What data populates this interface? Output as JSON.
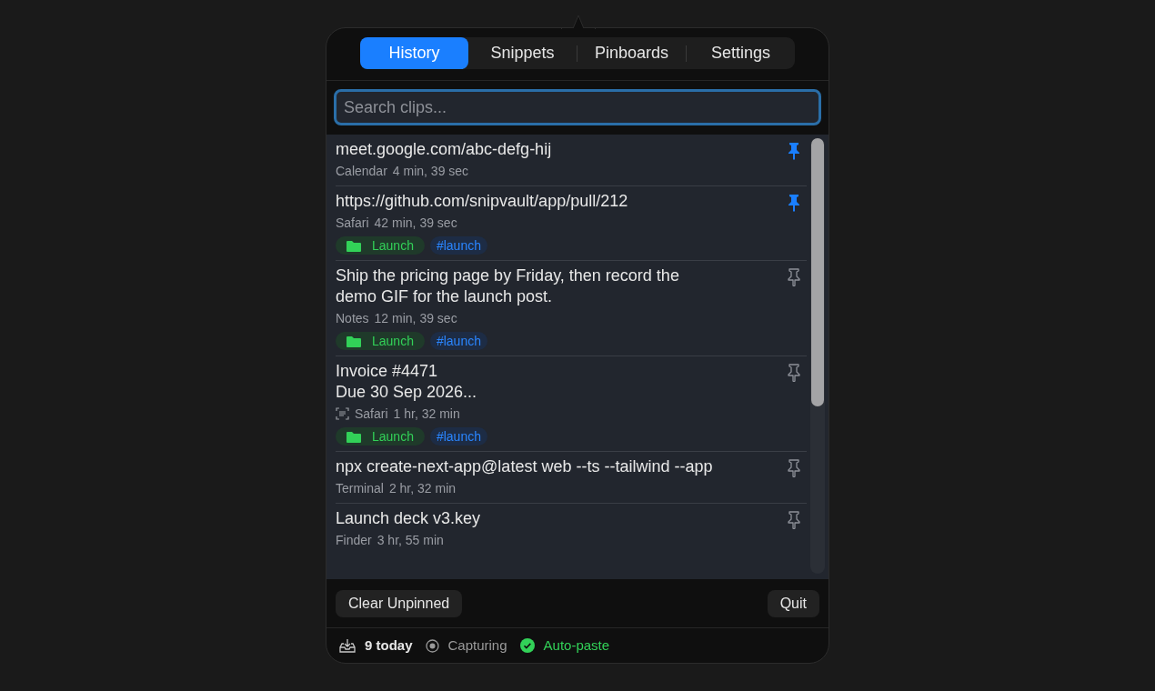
{
  "tabs": [
    {
      "label": "History",
      "selected": true
    },
    {
      "label": "Snippets",
      "selected": false
    },
    {
      "label": "Pinboards",
      "selected": false
    },
    {
      "label": "Settings",
      "selected": false
    }
  ],
  "search": {
    "placeholder": "Search clips..."
  },
  "clips": [
    {
      "title": "meet.google.com/abc-defg-hij",
      "app": "Calendar",
      "time": "4 min, 39 sec",
      "pinned": true,
      "text_recognized": false
    },
    {
      "title": "https://github.com/snipvault/app/pull/212",
      "app": "Safari",
      "time": "42 min, 39 sec",
      "pinned": true,
      "text_recognized": false,
      "tags": [
        {
          "kind": "folder",
          "label": "Launch"
        },
        {
          "kind": "hashtag",
          "label": "#launch"
        }
      ]
    },
    {
      "title": "Ship the pricing page by Friday, then record the demo GIF for the launch post.",
      "app": "Notes",
      "time": "12 min, 39 sec",
      "pinned": false,
      "text_recognized": false,
      "tags": [
        {
          "kind": "folder",
          "label": "Launch"
        },
        {
          "kind": "hashtag",
          "label": "#launch"
        }
      ]
    },
    {
      "title": "Invoice #4471\nDue 30 Sep 2026...",
      "app": "Safari",
      "time": "1 hr, 32 min",
      "pinned": false,
      "text_recognized": true,
      "tags": [
        {
          "kind": "folder",
          "label": "Launch"
        },
        {
          "kind": "hashtag",
          "label": "#launch"
        }
      ]
    },
    {
      "title": "npx create-next-app@latest web --ts --tailwind --app",
      "app": "Terminal",
      "time": "2 hr, 32 min",
      "pinned": false,
      "text_recognized": false
    },
    {
      "title": "Launch deck v3.key",
      "app": "Finder",
      "time": "3 hr, 55 min",
      "pinned": false,
      "text_recognized": false
    }
  ],
  "buttons": {
    "left": "Clear Unpinned",
    "right": "Quit"
  },
  "status": {
    "count": "9 today",
    "capture": "Capturing",
    "autopaste": {
      "label": "Auto-paste",
      "on": true
    }
  }
}
